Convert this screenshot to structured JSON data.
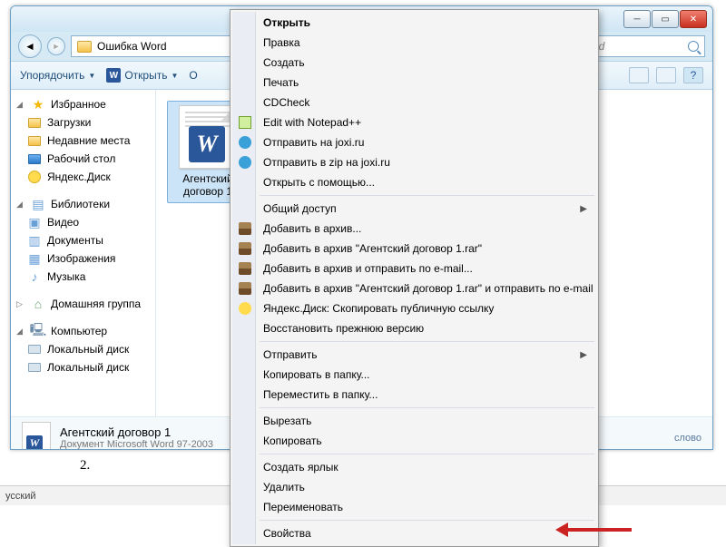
{
  "window": {
    "path_text": "Ошибка Word",
    "search_placeholder": "ord"
  },
  "toolbar": {
    "organize": "Упорядочить",
    "open": "Открыть",
    "ob_partial": "О"
  },
  "sidebar": {
    "favorites": {
      "label": "Избранное",
      "items": [
        "Загрузки",
        "Недавние места",
        "Рабочий стол",
        "Яндекс.Диск"
      ]
    },
    "libraries": {
      "label": "Библиотеки",
      "items": [
        "Видео",
        "Документы",
        "Изображения",
        "Музыка"
      ]
    },
    "homegroup": "Домашняя группа",
    "computer": {
      "label": "Компьютер",
      "items": [
        "Локальный диск",
        "Локальный диск"
      ]
    }
  },
  "file": {
    "line1": "Агентский",
    "line2": "договор 1"
  },
  "details": {
    "title": "Агентский договор 1",
    "subtitle": "Документ Microsoft Word 97-2003",
    "rtext": "слово"
  },
  "ctx": {
    "open": "Открыть",
    "edit": "Правка",
    "create": "Создать",
    "print": "Печать",
    "cdcheck": "CDCheck",
    "notepadpp": "Edit with Notepad++",
    "joxi_send": "Отправить на joxi.ru",
    "joxi_zip": "Отправить в zip на joxi.ru",
    "openwith": "Открыть с помощью...",
    "share": "Общий доступ",
    "rar_add": "Добавить в архив...",
    "rar_add_named": "Добавить в архив \"Агентский договор 1.rar\"",
    "rar_email": "Добавить в архив и отправить по e-mail...",
    "rar_email_named": "Добавить в архив \"Агентский договор 1.rar\" и отправить по e-mail",
    "yadisk": "Яндекс.Диск: Скопировать публичную ссылку",
    "restore": "Восстановить прежнюю версию",
    "sendto": "Отправить",
    "copyto": "Копировать в папку...",
    "moveto": "Переместить в папку...",
    "cut": "Вырезать",
    "copy": "Копировать",
    "shortcut": "Создать ярлык",
    "delete": "Удалить",
    "rename": "Переименовать",
    "properties": "Свойства"
  },
  "marker": "2.",
  "langbar": "усский"
}
